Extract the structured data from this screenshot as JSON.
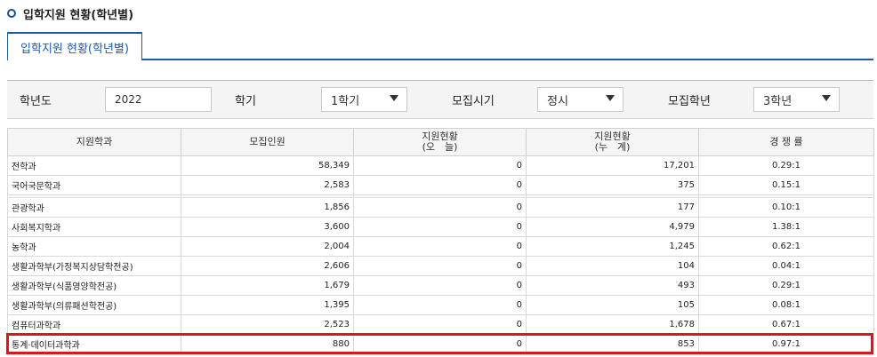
{
  "header": {
    "title": "입학지원 현황(학년별)"
  },
  "tabs": [
    {
      "label": "입학지원 현황(학년별)"
    }
  ],
  "filters": {
    "year": {
      "label": "학년도",
      "value": "2022"
    },
    "semester": {
      "label": "학기",
      "value": "1학기"
    },
    "period": {
      "label": "모집시기",
      "value": "정시"
    },
    "grade": {
      "label": "모집학년",
      "value": "3학년"
    }
  },
  "table": {
    "headers": [
      {
        "line1": "지원학과",
        "line2": ""
      },
      {
        "line1": "모집인원",
        "line2": ""
      },
      {
        "line1": "지원현황",
        "line2": "(오　늘)"
      },
      {
        "line1": "지원현황",
        "line2": "(누　계)"
      },
      {
        "line1": "경 쟁 률",
        "line2": ""
      }
    ],
    "rows": [
      {
        "dept": "전학과",
        "quota": "58,349",
        "today": "0",
        "total": "17,201",
        "rate": "0.29:1"
      },
      {
        "dept": "국어국문학과",
        "quota": "2,583",
        "today": "0",
        "total": "375",
        "rate": "0.15:1"
      },
      {
        "dept": "관광학과",
        "quota": "1,856",
        "today": "0",
        "total": "177",
        "rate": "0.10:1"
      },
      {
        "dept": "사회복지학과",
        "quota": "3,600",
        "today": "0",
        "total": "4,979",
        "rate": "1.38:1"
      },
      {
        "dept": "농학과",
        "quota": "2,004",
        "today": "0",
        "total": "1,245",
        "rate": "0.62:1"
      },
      {
        "dept": "생활과학부(가정복지상담학전공)",
        "quota": "2,606",
        "today": "0",
        "total": "104",
        "rate": "0.04:1"
      },
      {
        "dept": "생활과학부(식품영양학전공)",
        "quota": "1,679",
        "today": "0",
        "total": "493",
        "rate": "0.29:1"
      },
      {
        "dept": "생활과학부(의류패션학전공)",
        "quota": "1,395",
        "today": "0",
        "total": "105",
        "rate": "0.08:1"
      },
      {
        "dept": "컴퓨터과학과",
        "quota": "2,523",
        "today": "0",
        "total": "1,678",
        "rate": "0.67:1"
      },
      {
        "dept": "통계·데이터과학과",
        "quota": "880",
        "today": "0",
        "total": "853",
        "rate": "0.97:1"
      }
    ]
  },
  "colors": {
    "accent": "#1f5aa6",
    "highlight": "#e0141f"
  }
}
